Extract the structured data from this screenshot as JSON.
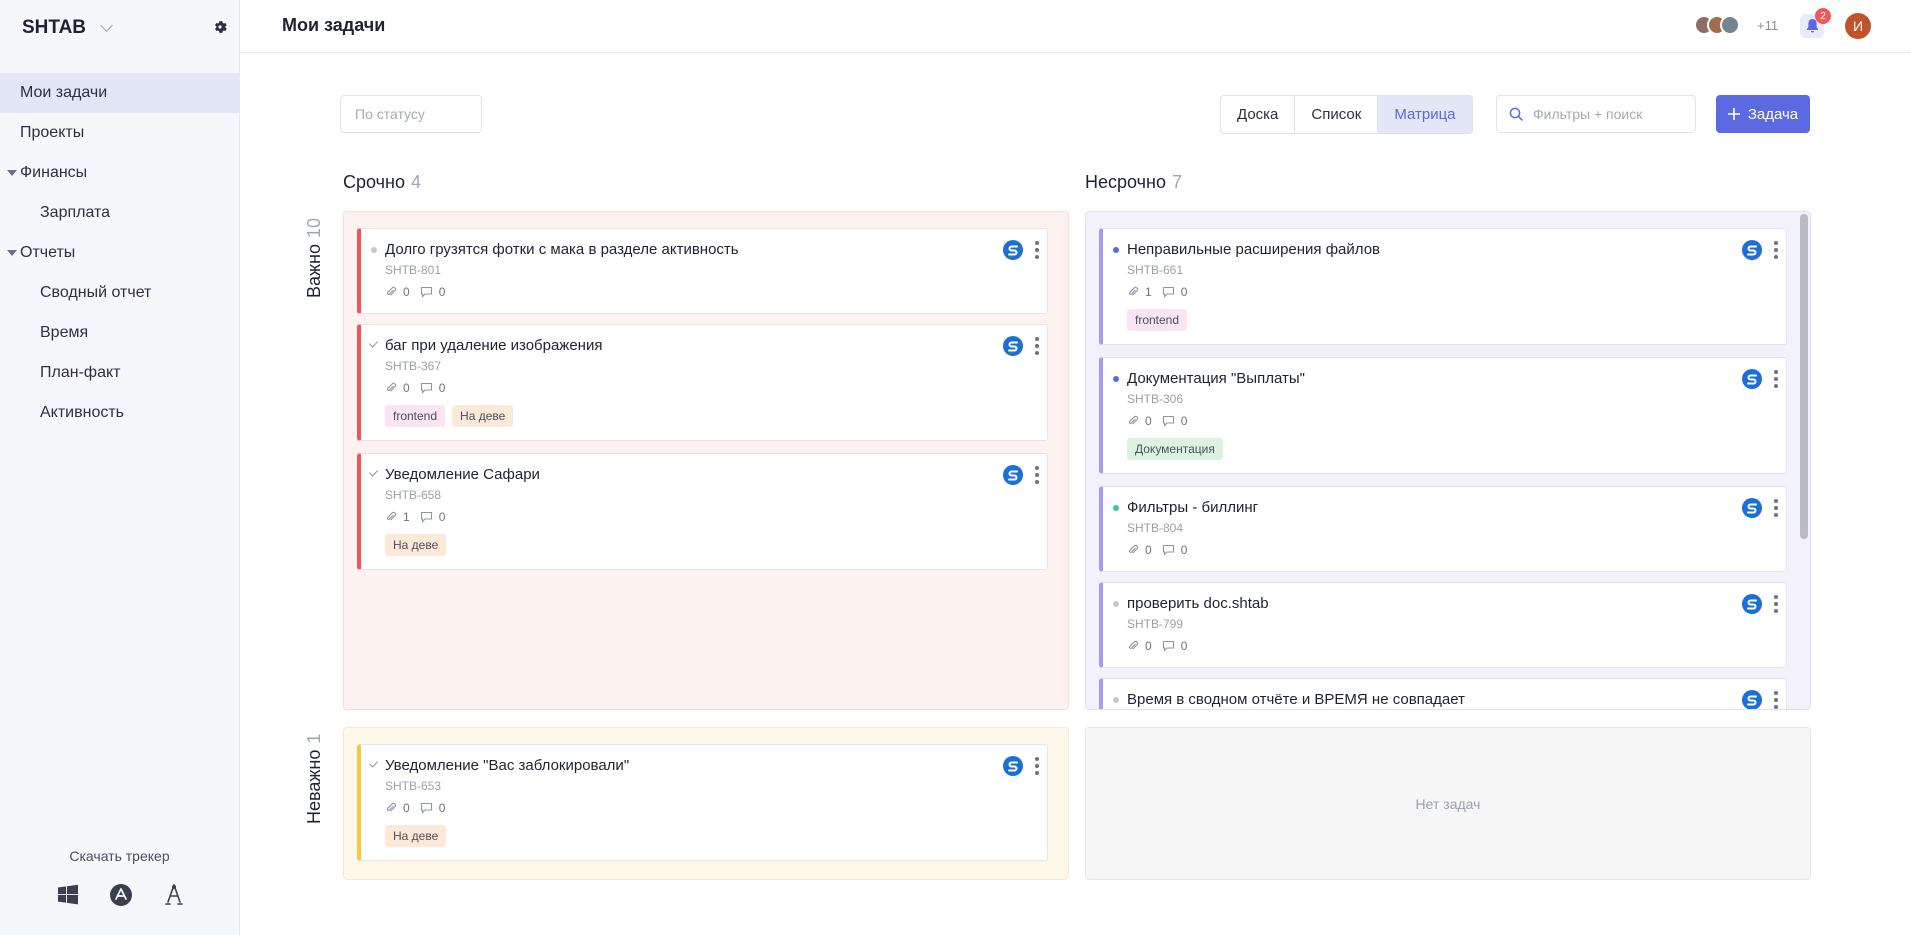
{
  "sidebar": {
    "brand": "SHTAB",
    "items": [
      {
        "label": "Мои задачи"
      },
      {
        "label": "Проекты"
      },
      {
        "label": "Финансы"
      },
      {
        "label": "Зарплата"
      },
      {
        "label": "Отчеты"
      },
      {
        "label": "Сводный отчет"
      },
      {
        "label": "Время"
      },
      {
        "label": "План-факт"
      },
      {
        "label": "Активность"
      }
    ],
    "download_label": "Скачать трекер",
    "os_icons": [
      "windows-icon",
      "app-store-icon",
      "linux-icon"
    ]
  },
  "header": {
    "title": "Мои задачи",
    "members_more": "+11",
    "notifications_count": "2",
    "user_initial": "И"
  },
  "toolbar": {
    "status_placeholder": "По статусу",
    "views": [
      "Доска",
      "Список",
      "Матрица"
    ],
    "active_view": "Матрица",
    "search_placeholder": "Фильтры + поиск",
    "add_label": "Задача"
  },
  "matrix": {
    "columns": [
      {
        "label": "Срочно",
        "count": "4"
      },
      {
        "label": "Несрочно",
        "count": "7"
      }
    ],
    "rows": [
      {
        "label": "Важно",
        "count": "10"
      },
      {
        "label": "Неважно",
        "count": "1"
      }
    ],
    "urgent_important": [
      {
        "title": "Долго грузятся фотки с мака в разделе активность",
        "code": "SHTB-801",
        "files": "0",
        "comments": "0",
        "tags": []
      },
      {
        "title": "баг при удаление изображения",
        "code": "SHTB-367",
        "files": "0",
        "comments": "0",
        "tags": [
          "frontend",
          "На деве"
        ]
      },
      {
        "title": "Уведомление Сафари",
        "code": "SHTB-658",
        "files": "1",
        "comments": "0",
        "tags": [
          "На деве"
        ]
      }
    ],
    "nonurgent_important": [
      {
        "title": "Неправильные расширения файлов",
        "code": "SHTB-661",
        "files": "1",
        "comments": "0",
        "tags": [
          "frontend"
        ]
      },
      {
        "title": "Документация \"Выплаты\"",
        "code": "SHTB-306",
        "files": "0",
        "comments": "0",
        "tags": [
          "Документация"
        ]
      },
      {
        "title": "Фильтры - биллинг",
        "code": "SHTB-804",
        "files": "0",
        "comments": "0",
        "tags": []
      },
      {
        "title": "проверить doc.shtab",
        "code": "SHTB-799",
        "files": "0",
        "comments": "0",
        "tags": []
      },
      {
        "title": "Время в сводном отчёте и ВРЕМЯ не совпадает"
      }
    ],
    "urgent_unimportant": [
      {
        "title": "Уведомление \"Вас заблокировали\"",
        "code": "SHTB-653",
        "files": "0",
        "comments": "0",
        "tags": [
          "На деве"
        ]
      }
    ],
    "empty_label": "Нет задач"
  },
  "colors": {
    "accent": "#5b6ae0",
    "urgent_important_border": "#f05454",
    "nonurgent_important_border": "#a99cf0",
    "urgent_unimportant_border": "#f6c945",
    "dot_blue": "#5b6ae0",
    "dot_green": "#3fc99a",
    "dot_grey": "#c4c7cf"
  }
}
